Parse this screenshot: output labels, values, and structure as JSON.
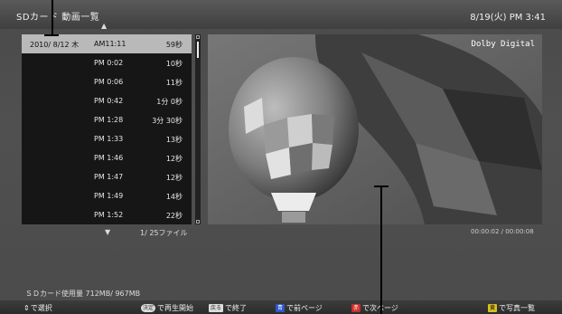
{
  "header": {
    "title": "SDカード 動画一覧",
    "clock": "8/19(火) PM  3:41"
  },
  "list": {
    "up_arrow": "▲",
    "down_arrow": "▼",
    "page_count": "1/  25ファイル",
    "rows": [
      {
        "date": "2010/ 8/12  木",
        "time": "AM11:11",
        "duration": "59秒",
        "selected": true
      },
      {
        "date": "",
        "time": "PM 0:02",
        "duration": "10秒"
      },
      {
        "date": "",
        "time": "PM 0:06",
        "duration": "11秒"
      },
      {
        "date": "",
        "time": "PM 0:42",
        "duration": "1分  0秒"
      },
      {
        "date": "",
        "time": "PM 1:28",
        "duration": "3分 30秒"
      },
      {
        "date": "",
        "time": "PM 1:33",
        "duration": "13秒"
      },
      {
        "date": "",
        "time": "PM 1:46",
        "duration": "12秒"
      },
      {
        "date": "",
        "time": "PM 1:47",
        "duration": "12秒"
      },
      {
        "date": "",
        "time": "PM 1:49",
        "duration": "14秒"
      },
      {
        "date": "",
        "time": "PM 1:52",
        "duration": "22秒"
      }
    ]
  },
  "preview": {
    "audio_badge": "Dolby Digital",
    "playtime": "00:00:02 / 00:00:08"
  },
  "status": {
    "usage": "ＳＤカード使用量   712MB/   967MB"
  },
  "footer": {
    "select_label": "で選択",
    "play_key": "決定",
    "play_label": "で再生開始",
    "back_key": "戻る",
    "back_label": "で終了",
    "blue_key": "青",
    "blue_label": "で前ページ",
    "red_key": "赤",
    "red_label": "で次ページ",
    "yellow_key": "黄",
    "yellow_label": "で写真一覧"
  },
  "colors": {
    "blue": "#2f55c8",
    "red": "#c8302c",
    "yellow": "#d8c020",
    "selected_row": "#b9b9b9"
  }
}
